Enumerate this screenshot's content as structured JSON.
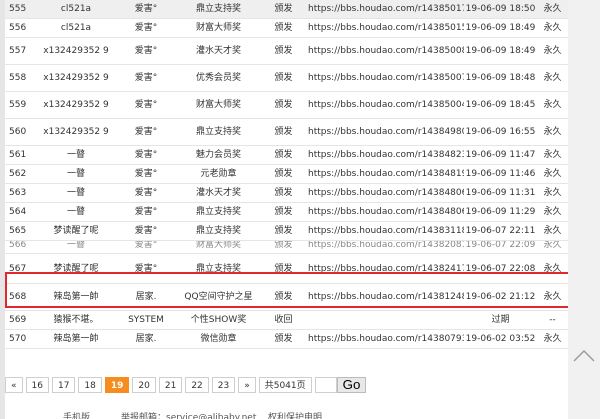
{
  "rows": [
    {
      "num": "555",
      "user": "cl521a",
      "type": "爱害°",
      "badge": "鼎立支持奖",
      "action": "颁发",
      "url": "https://bbs.houdao.com/r14385017",
      "time": "19-06-09 18:50",
      "dur": "永久"
    },
    {
      "num": "556",
      "user": "cl521a",
      "type": "爱害°",
      "badge": "财富大师奖",
      "action": "颁发",
      "url": "https://bbs.houdao.com/r14385015",
      "time": "19-06-09 18:49",
      "dur": "永久"
    },
    {
      "num": "557",
      "user": "x132429352 9",
      "type": "爱害°",
      "badge": "灌水天才奖",
      "action": "颁发",
      "url": "https://bbs.houdao.com/r14385008",
      "time": "19-06-09 18:49",
      "dur": "永久"
    },
    {
      "num": "558",
      "user": "x132429352 9",
      "type": "爱害°",
      "badge": "优秀会员奖",
      "action": "颁发",
      "url": "https://bbs.houdao.com/r14385007",
      "time": "19-06-09 18:48",
      "dur": "永久"
    },
    {
      "num": "559",
      "user": "x132429352 9",
      "type": "爱害°",
      "badge": "财富大师奖",
      "action": "颁发",
      "url": "https://bbs.houdao.com/r14385004",
      "time": "19-06-09 18:45",
      "dur": "永久"
    },
    {
      "num": "560",
      "user": "x132429352 9",
      "type": "爱害°",
      "badge": "鼎立支持奖",
      "action": "颁发",
      "url": "https://bbs.houdao.com/r14384980",
      "time": "19-06-09 16:55",
      "dur": "永久"
    },
    {
      "num": "561",
      "user": "一瞽",
      "type": "爱害°",
      "badge": "魅力会员奖",
      "action": "颁发",
      "url": "https://bbs.houdao.com/r14384823",
      "time": "19-06-09 11:47",
      "dur": "永久"
    },
    {
      "num": "562",
      "user": "一瞽",
      "type": "爱害°",
      "badge": "元老勋章",
      "action": "颁发",
      "url": "https://bbs.houdao.com/r14384819",
      "time": "19-06-09 11:46",
      "dur": "永久"
    },
    {
      "num": "563",
      "user": "一瞽",
      "type": "爱害°",
      "badge": "灌水天才奖",
      "action": "颁发",
      "url": "https://bbs.houdao.com/r14384806",
      "time": "19-06-09 11:31",
      "dur": "永久"
    },
    {
      "num": "564",
      "user": "一瞽",
      "type": "爱害°",
      "badge": "鼎立支持奖",
      "action": "颁发",
      "url": "https://bbs.houdao.com/r14384806",
      "time": "19-06-09 11:29",
      "dur": "永久"
    },
    {
      "num": "565",
      "user": "梦读醒了呢",
      "type": "爱害°",
      "badge": "鼎立支持奖",
      "action": "颁发",
      "url": "https://bbs.houdao.com/r14383118",
      "time": "19-06-07 22:11",
      "dur": "永久"
    },
    {
      "num": "566",
      "user": "一瞽",
      "type": "爱害°",
      "badge": "财富大师奖",
      "action": "颁发",
      "url": "https://bbs.houdao.com/r14382081",
      "time": "19-06-07 22:09",
      "dur": "永久"
    },
    {
      "num": "567",
      "user": "梦读醒了呢",
      "type": "爱害°",
      "badge": "鼎立支持奖",
      "action": "颁发",
      "url": "https://bbs.houdao.com/r14382417",
      "time": "19-06-07 22:08",
      "dur": "永久"
    },
    {
      "num": "568",
      "user": "辣岛第一帥",
      "type": "居家.",
      "badge": "QQ空间守护之星",
      "action": "颁发",
      "url": "https://bbs.houdao.com/r14381248",
      "time": "19-06-02 21:12",
      "dur": "永久"
    },
    {
      "num": "569",
      "user": "猿猴不堪。",
      "type": "SYSTEM",
      "badge": "个性SHOW奖",
      "action": "收回",
      "url": "",
      "time": "过期",
      "dur": "--"
    },
    {
      "num": "570",
      "user": "辣岛第一帥",
      "type": "居家.",
      "badge": "微信勋章",
      "action": "颁发",
      "url": "https://bbs.houdao.com/r14380793",
      "time": "19-06-02 03:52",
      "dur": "永久"
    }
  ],
  "pager": {
    "prev": "«",
    "pages": [
      "16",
      "17",
      "18",
      "19",
      "20",
      "21",
      "22",
      "23"
    ],
    "current": "19",
    "next": "»",
    "total": "共5041页",
    "go": "Go"
  },
  "footer": {
    "mobile": "手机版",
    "report": "举报邮箱：service@alibaby.net",
    "privacy": "权利保护申明"
  },
  "colors": {
    "highlight": "#e0282e",
    "current_page": "#f58e1f"
  },
  "icons": {
    "scroll_top": "chevron-up-icon"
  }
}
